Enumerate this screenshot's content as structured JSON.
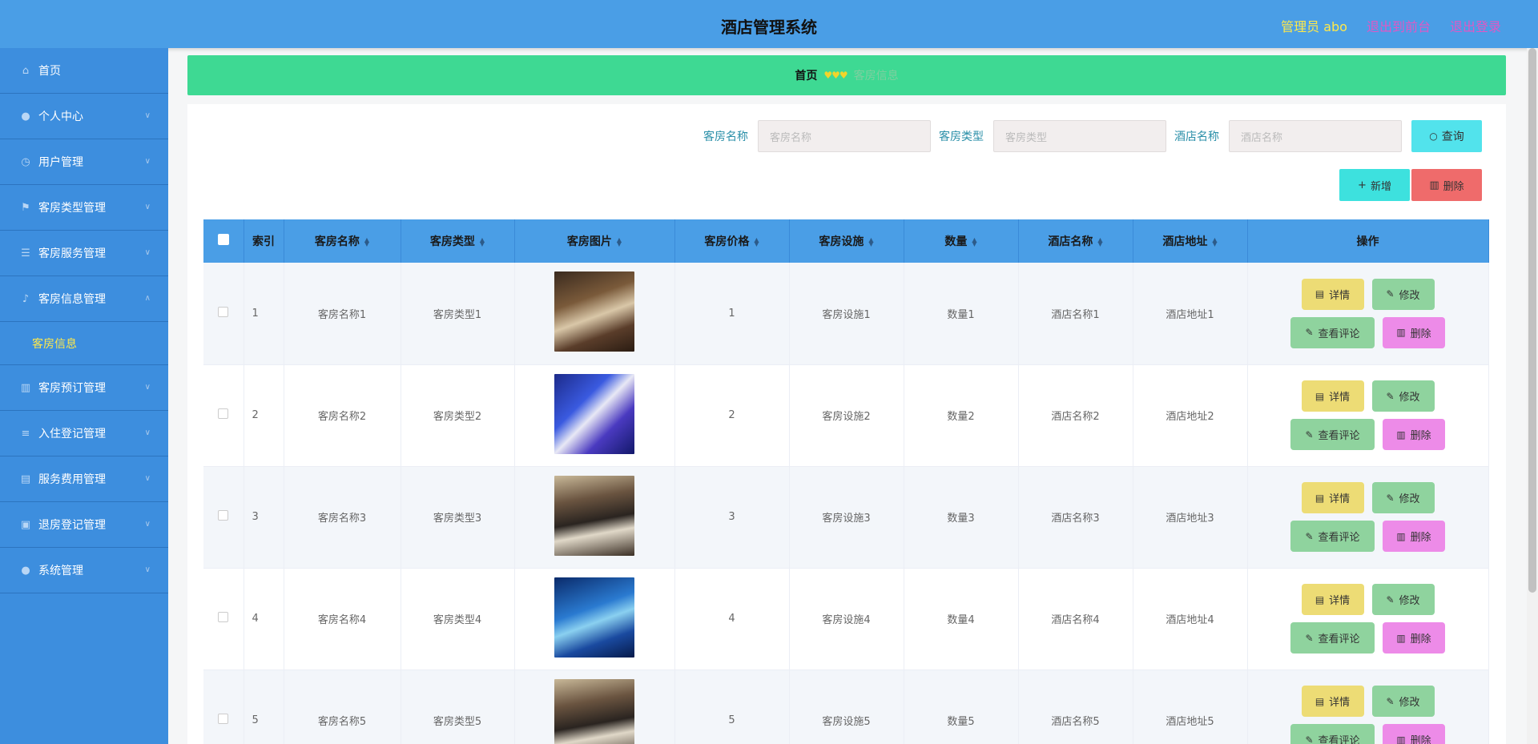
{
  "header": {
    "title": "酒店管理系统",
    "admin": "管理员 abo",
    "exit_front": "退出到前台",
    "logout": "退出登录"
  },
  "sidebar": {
    "items": [
      {
        "label": "首页",
        "icon": "home-icon"
      },
      {
        "label": "个人中心",
        "icon": "user-icon"
      },
      {
        "label": "用户管理",
        "icon": "clock-icon"
      },
      {
        "label": "客房类型管理",
        "icon": "flag-icon"
      },
      {
        "label": "客房服务管理",
        "icon": "sliders-icon"
      },
      {
        "label": "客房信息管理",
        "icon": "mic-icon"
      },
      {
        "label": "客房预订管理",
        "icon": "bar-chart-icon"
      },
      {
        "label": "入住登记管理",
        "icon": "list-icon"
      },
      {
        "label": "服务费用管理",
        "icon": "clipboard-icon"
      },
      {
        "label": "退房登记管理",
        "icon": "suitcase-icon"
      },
      {
        "label": "系统管理",
        "icon": "user-icon"
      }
    ],
    "sub_item": "客房信息"
  },
  "breadcrumb": {
    "home": "首页",
    "separator": "♥♥♥",
    "current": "客房信息"
  },
  "search": {
    "room_name_label": "客房名称",
    "room_name_placeholder": "客房名称",
    "room_type_label": "客房类型",
    "room_type_placeholder": "客房类型",
    "hotel_name_label": "酒店名称",
    "hotel_name_placeholder": "酒店名称",
    "query_button": "查询"
  },
  "actions": {
    "add": "新增",
    "delete": "删除"
  },
  "table": {
    "headers": [
      "索引",
      "客房名称",
      "客房类型",
      "客房图片",
      "客房价格",
      "客房设施",
      "数量",
      "酒店名称",
      "酒店地址",
      "操作"
    ],
    "rows": [
      {
        "index": "1",
        "name": "客房名称1",
        "type": "客房类型1",
        "price": "1",
        "facility": "客房设施1",
        "quantity": "数量1",
        "hotel": "酒店名称1",
        "address": "酒店地址1"
      },
      {
        "index": "2",
        "name": "客房名称2",
        "type": "客房类型2",
        "price": "2",
        "facility": "客房设施2",
        "quantity": "数量2",
        "hotel": "酒店名称2",
        "address": "酒店地址2"
      },
      {
        "index": "3",
        "name": "客房名称3",
        "type": "客房类型3",
        "price": "3",
        "facility": "客房设施3",
        "quantity": "数量3",
        "hotel": "酒店名称3",
        "address": "酒店地址3"
      },
      {
        "index": "4",
        "name": "客房名称4",
        "type": "客房类型4",
        "price": "4",
        "facility": "客房设施4",
        "quantity": "数量4",
        "hotel": "酒店名称4",
        "address": "酒店地址4"
      },
      {
        "index": "5",
        "name": "客房名称5",
        "type": "客房类型5",
        "price": "5",
        "facility": "客房设施5",
        "quantity": "数量5",
        "hotel": "酒店名称5",
        "address": "酒店地址5"
      }
    ],
    "op_labels": {
      "detail": "详情",
      "edit": "修改",
      "review": "查看评论",
      "delete": "删除"
    }
  }
}
